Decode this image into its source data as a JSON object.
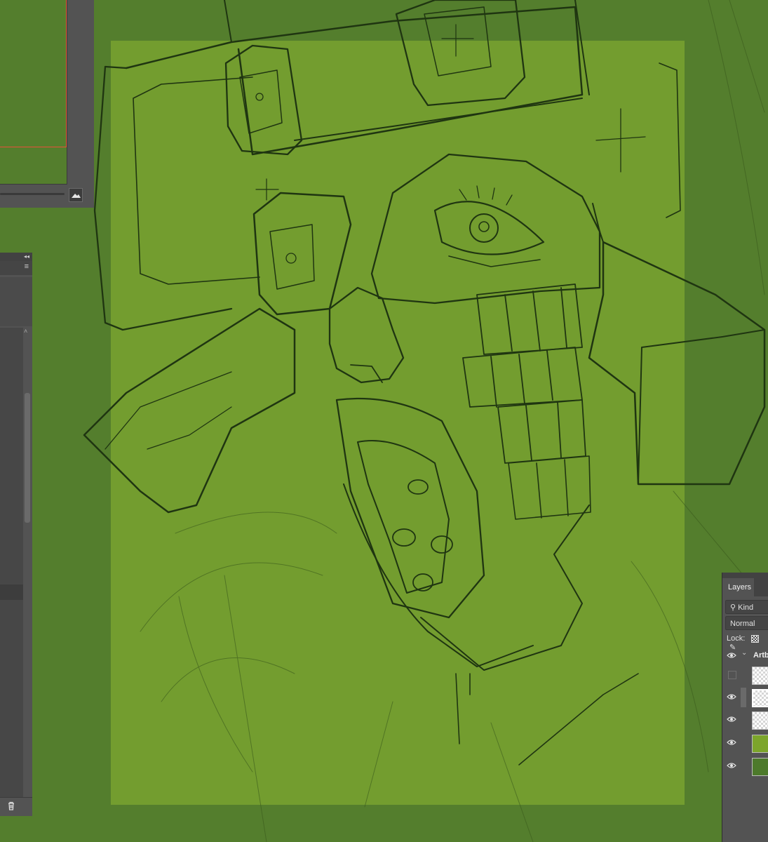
{
  "colors": {
    "workspace": "#547e2d",
    "artboard": "#739d2f",
    "panel": "#535353",
    "accent": "#e8503a"
  },
  "navigator": {
    "zoom_icon": "mountain-icon"
  },
  "left_panel": {
    "collapse_label": "◂◂",
    "menu_icon": "hamburger-icon",
    "trash_icon": "trash-icon"
  },
  "layers": {
    "tab_label": "Layers",
    "filter_label": "Kind",
    "filter_icon": "search-icon",
    "blend_mode": "Normal",
    "lock_label": "Lock:",
    "group_name": "Artb",
    "rows": [
      {
        "visible": false,
        "thumb": "transparent"
      },
      {
        "visible": true,
        "thumb": "transparent",
        "selected": true
      },
      {
        "visible": true,
        "thumb": "transparent"
      },
      {
        "visible": true,
        "thumb": "#7ca52b"
      },
      {
        "visible": true,
        "thumb": "#4d7a2b"
      }
    ]
  }
}
